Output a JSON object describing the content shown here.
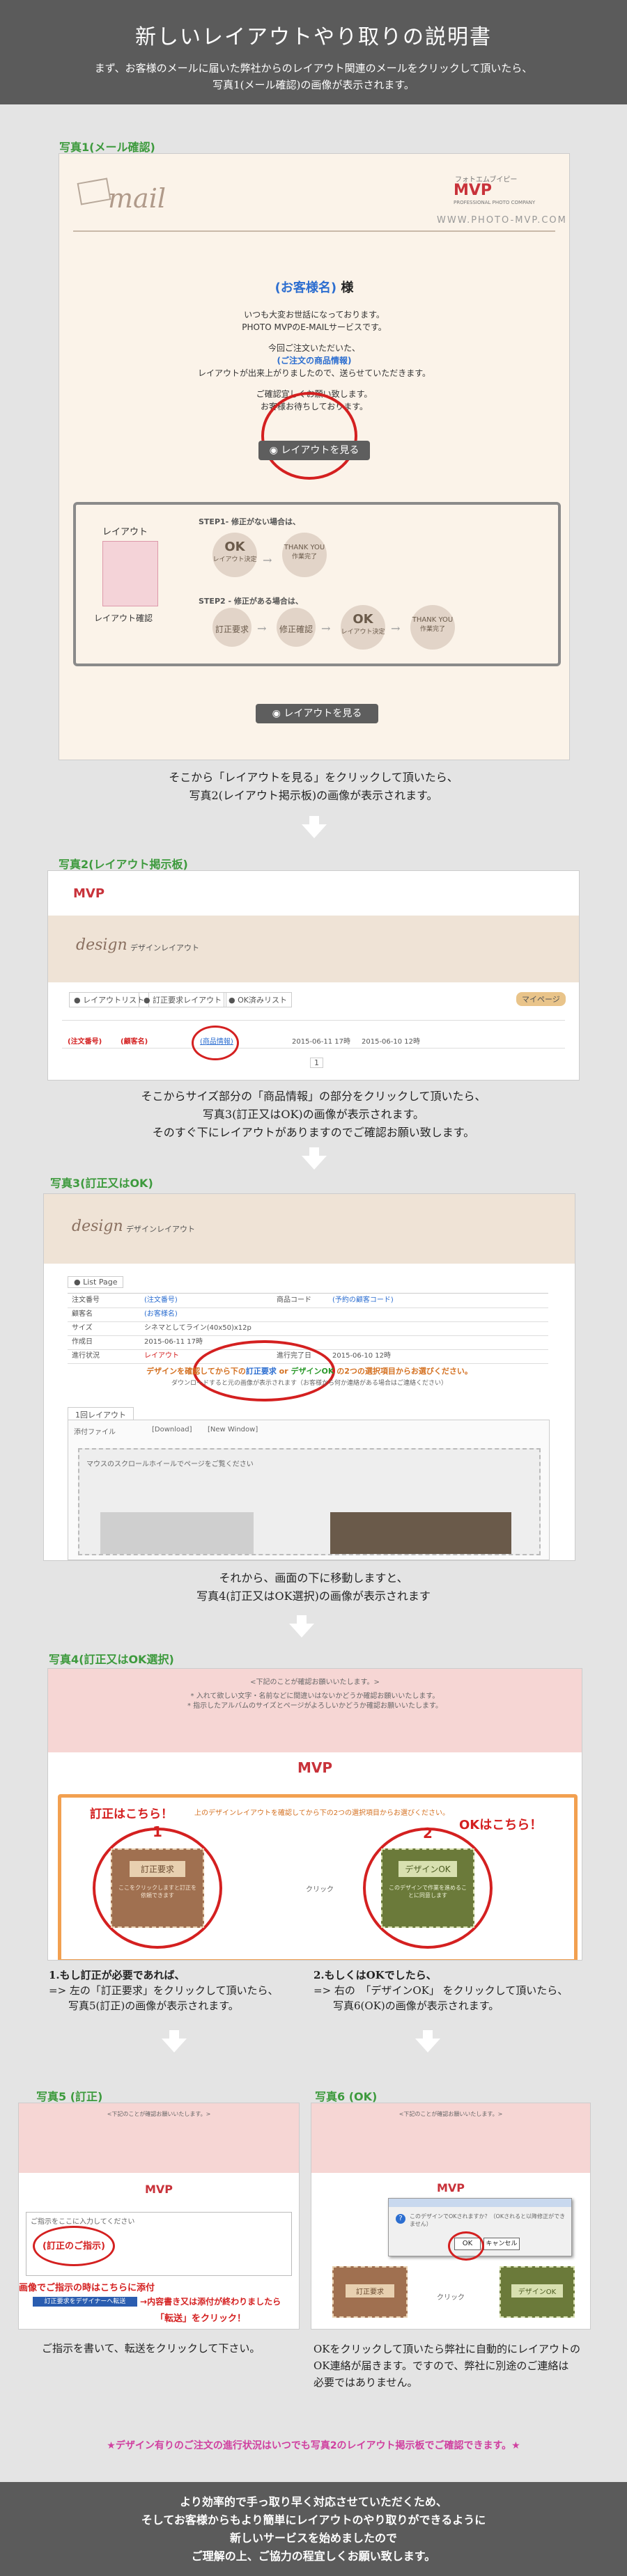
{
  "header": {
    "title": "新しいレイアウトやり取りの説明書",
    "line1": "まず、お客様のメールに届いた弊社からのレイアウト関連のメールをクリックして頂いたら、",
    "line2": "写真1(メール確認)の画像が表示されます。"
  },
  "s1": {
    "label": "写真1(メール確認)",
    "mail_logo": "mail",
    "brand_kana": "フォトエムブイピー",
    "brand": "MVP",
    "brand_sub": "PROFESSIONAL PHOTO COMPANY",
    "url": "WWW.PHOTO-MVP.COM",
    "customer": "(お客様名)",
    "sama": "様",
    "l1": "いつも大変お世話になっております。",
    "l2": "PHOTO MVPのE-MAILサービスです。",
    "l3": "今回ご注文いただいた、",
    "l4": "(ご注文の商品情報)",
    "l5": "レイアウトが出来上がりましたので、送らせていただきます。",
    "l6": "ご確認宜しくお願い致します。",
    "l7": "お客様お待ちしております。",
    "view_button": "レイアウトを見る",
    "layout_label": "レイアウト",
    "layout_confirm": "レイアウト確認",
    "step1": "STEP1- 修正がない場合は、",
    "step2": "STEP2 - 修正がある場合は、",
    "ok_big": "OK",
    "layout_ok": "レイアウト決定",
    "thank": "THANK YOU",
    "done": "作業完了",
    "fix_req": "訂正要求",
    "fix_check": "修正確認",
    "view_button2": "レイアウトを見る"
  },
  "cap1": {
    "l1": "そこから「レイアウトを見る」をクリックして頂いたら、",
    "l2": "写真2(レイアウト掲示板)の画像が表示されます。"
  },
  "s2": {
    "label": "写真2(レイアウト掲示板)",
    "design": "design",
    "design_jp": "デザインレイアウト",
    "tab1": "レイアウトリスト",
    "tab2": "訂正要求レイアウト",
    "tab3": "OK済みリスト",
    "mypage": "マイページ",
    "size_link": "(商品情報)",
    "order_no": "(注文番号)",
    "customer": "(顧客名)",
    "date1": "2015-06-11 17時",
    "date2": "2015-06-10 12時",
    "page": "1"
  },
  "cap2": {
    "l1": "そこからサイズ部分の「商品情報」の部分をクリックして頂いたら、",
    "l2": "写真3(訂正又はOK)の画像が表示されます。",
    "l3": "そのすぐ下にレイアウトがありますのでご確認お願い致します。"
  },
  "s3": {
    "label": "写真3(訂正又はOK)",
    "design": "design",
    "design_jp": "デザインレイアウト",
    "list_btn": "List Page",
    "r1k": "注文番号",
    "r1v": "(注文番号)",
    "r1k2": "商品コード",
    "r1v2": "(予約の顧客コード)",
    "r2k": "顧客名",
    "r2v": "(お客様名)",
    "r3k": "サイズ",
    "r3v": "シネマとしてライン(40x50)x12p",
    "r4k": "作成日",
    "r4v": "2015-06-11 17時",
    "r5k": "進行状況",
    "r5v": "レイアウト",
    "r5k2": "進行完了日",
    "r5v2": "2015-06-10 12時",
    "notice_a": "デザインを確認してから下の",
    "notice_fix": "訂正要求",
    "notice_or": " or ",
    "notice_ok": "デザインOK",
    "notice_b": " の2つの選択項目からお選びください。",
    "notice_sub": "ダウンロードすると元の画像が表示されます（お客様から何か連絡がある場合はご連絡ください）",
    "tab": "1回レイアウト",
    "file_k": "添付ファイル",
    "download": "[Download]",
    "newwin": "[New Window]",
    "scroll_hint": "マウスのスクロールホイールでページをご覧ください"
  },
  "cap3": {
    "l1": "それから、画面の下に移動しますと、",
    "l2": "写真4(訂正又はOK選択)の画像が表示されます"
  },
  "s4": {
    "label": "写真4(訂正又はOK選択)",
    "top_note": "<下記のことが確認お願いいたします。>",
    "note1": "* 入れて欲しい文字・名前などに間違いはないかどうか確認お願いいたします。",
    "note2": "* 指示したアルバムのサイズとページがよろしいかどうか確認お願いいたします。",
    "brand": "MVP",
    "choose_text": "上のデザインレイアウトを確認してから下の2つの選択項目からお選びください。",
    "fix_here": "訂正はこちら！",
    "ok_here": "OKはこちら！",
    "n1": "1",
    "n2": "2",
    "fix_card": "訂正要求",
    "fix_card_sub": "ここをクリックしますと訂正を依頼できます",
    "click": "クリック",
    "ok_card": "デザインOK",
    "ok_card_sub": "このデザインで作業を進めることに同意します"
  },
  "opt1": {
    "l1": "1.もし訂正が必要であれば、",
    "l2": "=> 左の「訂正要求」をクリックして頂いたら、",
    "l3": "写真5(訂正)の画像が表示されます。"
  },
  "opt2": {
    "l1": "2.もしくはOKでしたら、",
    "l2": "=> 右の　「デザインOK」 をクリックして頂いたら、",
    "l3": "写真6(OK)の画像が表示されます。"
  },
  "s5": {
    "label": "写真5 (訂正)",
    "top_note": "<下記のことが確認お願いいたします。>",
    "brand": "MVP",
    "instr_label": "(訂正のご指示)",
    "field_hint": "ご指示をここに入力してください",
    "attach_label": "画像でご指示の時はこちらに添付",
    "send_btn": "訂正要求をデザイナーへ転送",
    "done_note": "内容書き又は添付が終わりましたら",
    "send_click": "「転送」をクリック！"
  },
  "s6": {
    "label": "写真6 (OK)",
    "top_note": "<下記のことが確認お願いいたします。>",
    "brand": "MVP",
    "dialog_q": "このデザインでOKされますか？（OKされると以降修正ができません）",
    "ok_btn": "OK",
    "cancel_btn": "キャンセル",
    "fix_card": "訂正要求",
    "ok_card": "デザインOK",
    "click": "クリック"
  },
  "cap5": "ご指示を書いて、転送をクリックして下さい。",
  "cap6": {
    "l1": "OKをクリックして頂いたら弊社に自動的にレイアウトの",
    "l2": "OK連絡が届きます。ですので、弊社に別途のご連絡は",
    "l3": "必要ではありません。"
  },
  "pink_note": "★デザイン有りのご注文の進行状況はいつでも写真2のレイアウト掲示板でご確認できます。★",
  "footer": {
    "l1": "より効率的で手っ取り早く対応させていただくため、",
    "l2": "そしてお客様からもより簡単にレイアウトのやり取りができるように",
    "l3": "新しいサービスを始めましたので",
    "l4": "ご理解の上、ご協力の程宜しくお願い致します。"
  }
}
